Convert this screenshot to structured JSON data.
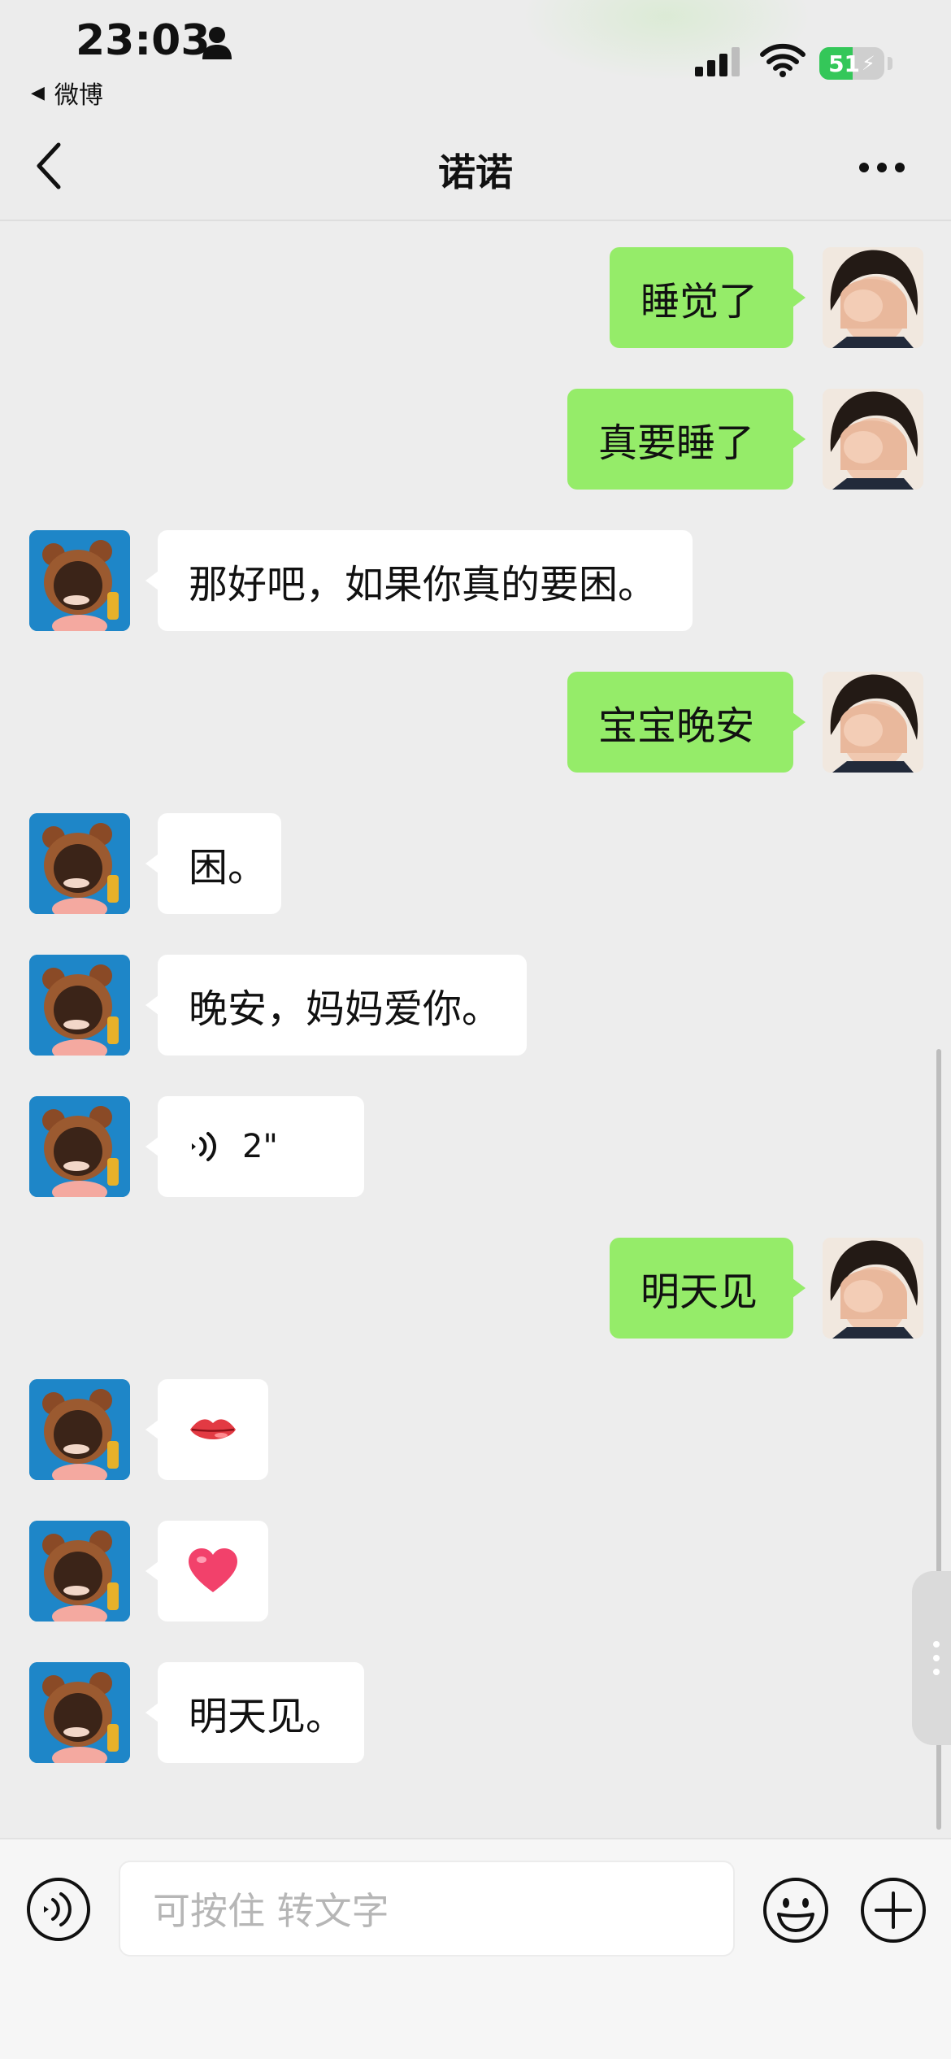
{
  "status_bar": {
    "time": "23:03",
    "back_app_arrow": "◀",
    "back_app": "微博",
    "battery_level": "51",
    "battery_charging": true,
    "icons": [
      "person-icon",
      "signal-icon",
      "wifi-icon",
      "battery-icon",
      "charging-bolt-icon"
    ]
  },
  "header": {
    "title": "诺诺",
    "back_icon": "chevron-left-icon",
    "more_icon": "more-dots-icon"
  },
  "messages": [
    {
      "side": "right",
      "type": "text",
      "text": "睡觉了"
    },
    {
      "side": "right",
      "type": "text",
      "text": "真要睡了"
    },
    {
      "side": "left",
      "type": "text",
      "text": "那好吧，如果你真的要困。"
    },
    {
      "side": "right",
      "type": "text",
      "text": "宝宝晚安"
    },
    {
      "side": "left",
      "type": "text",
      "text": "困。"
    },
    {
      "side": "left",
      "type": "text",
      "text": "晚安，妈妈爱你。"
    },
    {
      "side": "left",
      "type": "voice",
      "duration": "2\""
    },
    {
      "side": "right",
      "type": "text",
      "text": "明天见"
    },
    {
      "side": "left",
      "type": "emoji",
      "emoji": "lips-emoji"
    },
    {
      "side": "left",
      "type": "emoji",
      "emoji": "heart-emoji"
    },
    {
      "side": "left",
      "type": "text",
      "text": "明天见。"
    }
  ],
  "input_bar": {
    "placeholder": "可按住 转文字",
    "icons": [
      "voice-toggle-icon",
      "emoji-icon",
      "plus-icon"
    ]
  },
  "colors": {
    "background": "#ededed",
    "sent_bubble": "#95ec69",
    "received_bubble": "#ffffff",
    "left_avatar_bg": "#1e86c8",
    "battery_green": "#34c759"
  }
}
